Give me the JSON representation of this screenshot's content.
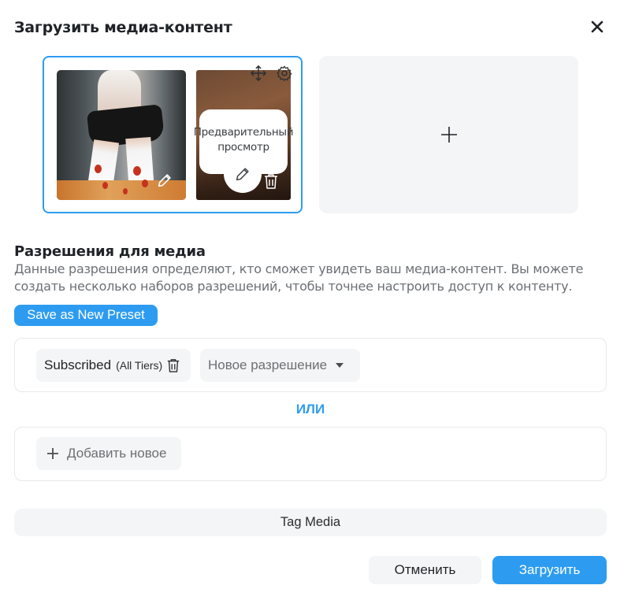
{
  "dialog": {
    "title": "Загрузить медиа-контент"
  },
  "media": {
    "preview_label": "Предварительный просмотр"
  },
  "permissions": {
    "title": "Разрешения для медиа",
    "description": "Данные разрешения определяют, кто сможет увидеть ваш медиа-контент. Вы можете создать несколько наборов разрешений, чтобы точнее настроить доступ к контенту.",
    "preset_button": "Save as New Preset",
    "sets": [
      {
        "chip_label": "Subscribed",
        "chip_tier": "(All Tiers)",
        "new_permission_placeholder": "Новое разрешение"
      }
    ],
    "or_label": "ИЛИ",
    "add_new_label": "Добавить новое"
  },
  "tag_media_label": "Tag Media",
  "footer": {
    "cancel_label": "Отменить",
    "upload_label": "Загрузить"
  },
  "colors": {
    "accent": "#2d9cf0",
    "chip_bg": "#f4f5f6",
    "border": "#e7e9eb",
    "text_primary": "#1f2328",
    "text_secondary": "#6b7075"
  },
  "icons": [
    "close-icon",
    "move-icon",
    "settings-icon",
    "pencil-icon",
    "trash-icon",
    "plus-icon",
    "caret-down-icon"
  ]
}
